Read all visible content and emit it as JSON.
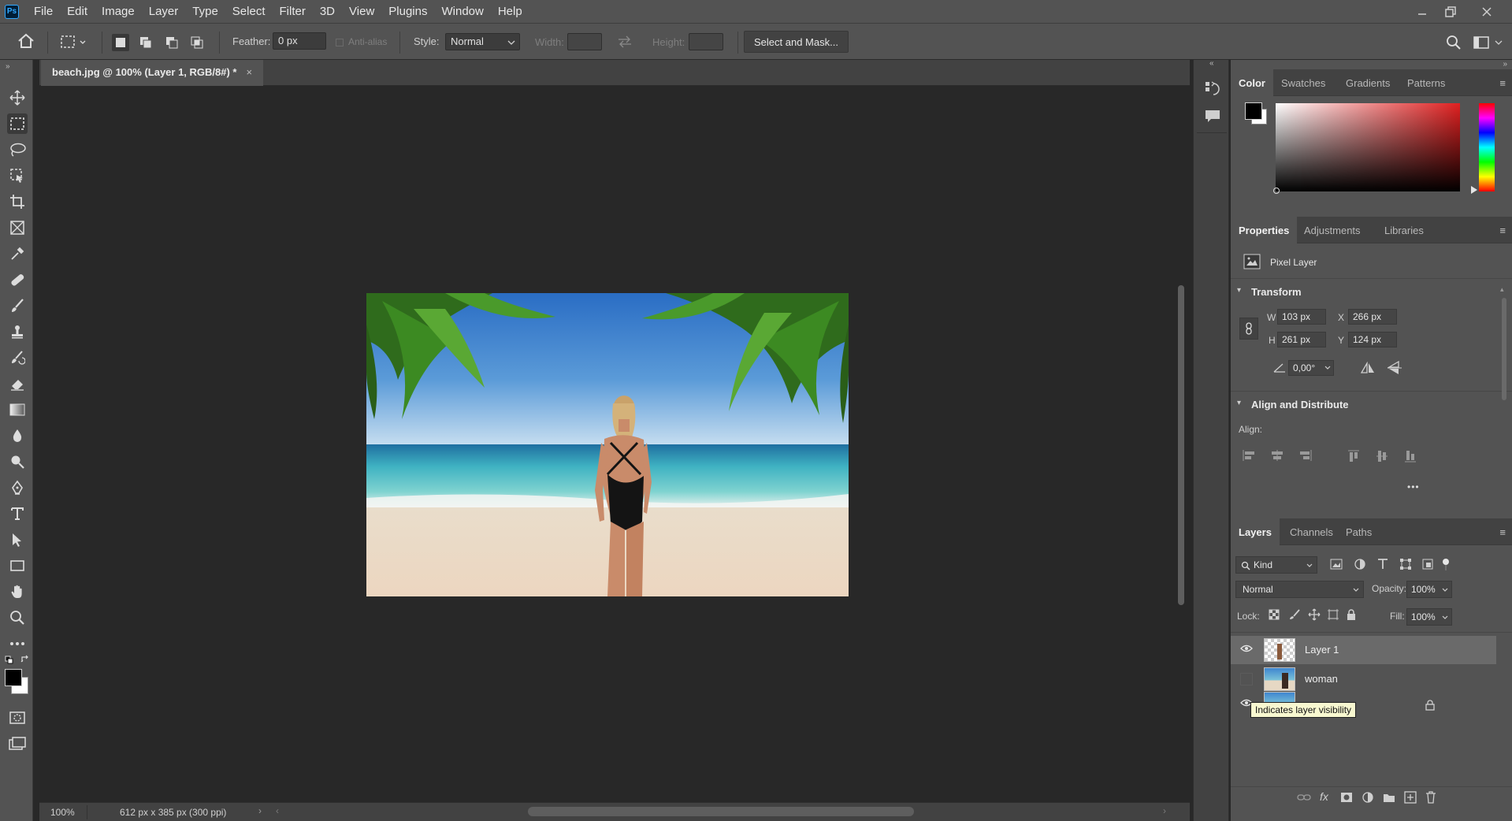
{
  "app": {
    "logo": "Ps"
  },
  "menu": [
    "File",
    "Edit",
    "Image",
    "Layer",
    "Type",
    "Select",
    "Filter",
    "3D",
    "View",
    "Plugins",
    "Window",
    "Help"
  ],
  "options": {
    "feather_label": "Feather:",
    "feather_value": "0 px",
    "antialias_label": "Anti-alias",
    "style_label": "Style:",
    "style_value": "Normal",
    "width_label": "Width:",
    "height_label": "Height:",
    "select_mask_label": "Select and Mask..."
  },
  "document": {
    "tab_title": "beach.jpg @ 100% (Layer 1, RGB/8#) *",
    "close_glyph": "×",
    "zoom": "100%",
    "doc_info": "612 px x 385 px (300 ppi)"
  },
  "color_panel": {
    "tabs": [
      "Color",
      "Swatches",
      "Gradients",
      "Patterns"
    ],
    "foreground": "#000000",
    "background": "#ffffff",
    "hue_color": "#e02020"
  },
  "properties_panel": {
    "tabs": [
      "Properties",
      "Adjustments",
      "Libraries"
    ],
    "layer_type": "Pixel Layer",
    "transform_title": "Transform",
    "w_label": "W",
    "w_value": "103 px",
    "h_label": "H",
    "h_value": "261 px",
    "x_label": "X",
    "x_value": "266 px",
    "y_label": "Y",
    "y_value": "124 px",
    "angle_value": "0,00°",
    "align_title": "Align and Distribute",
    "align_label": "Align:",
    "more_glyph": "•••"
  },
  "layers_panel": {
    "tabs": [
      "Layers",
      "Channels",
      "Paths"
    ],
    "kind_label": "Kind",
    "blend_mode": "Normal",
    "opacity_label": "Opacity:",
    "opacity_value": "100%",
    "lock_label": "Lock:",
    "fill_label": "Fill:",
    "fill_value": "100%",
    "layers": [
      {
        "name": "Layer 1",
        "visible": true,
        "selected": true
      },
      {
        "name": "woman",
        "visible": false,
        "selected": false
      },
      {
        "name": "",
        "visible": true,
        "selected": false,
        "locked": true
      }
    ],
    "tooltip": "Indicates layer visibility"
  }
}
